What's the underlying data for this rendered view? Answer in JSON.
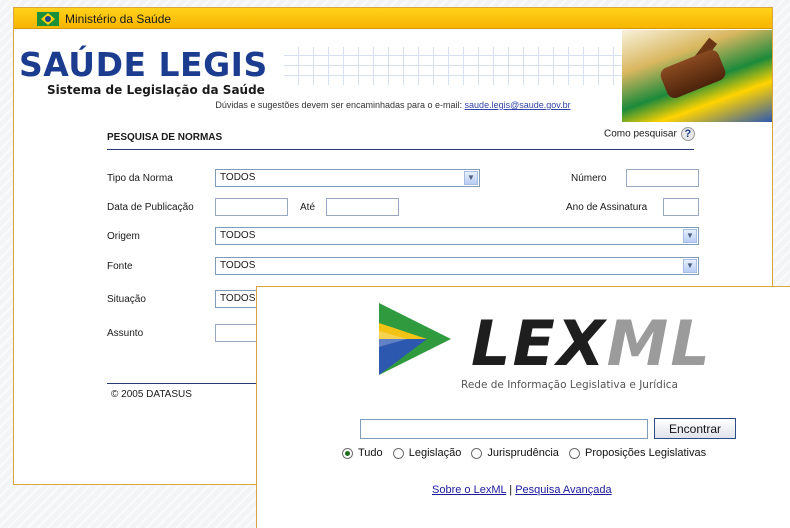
{
  "saude_window": {
    "gov_bar_title": "Ministério da Saúde",
    "logo_title": "SAÚDE LEGIS",
    "logo_subtitle": "Sistema de Legislação da Saúde",
    "contact_text": "Dúvidas e sugestões devem ser encaminhadas para o e-mail:",
    "contact_email": "saude.legis@saude.gov.br",
    "form": {
      "title": "PESQUISA DE NORMAS",
      "help_label": "Como pesquisar",
      "help_icon": "?",
      "tipo_label": "Tipo da Norma",
      "tipo_value": "TODOS",
      "numero_label": "Número",
      "numero_value": "",
      "data_label": "Data de Publicação",
      "ate_label": "Até",
      "ano_label": "Ano de Assinatura",
      "origem_label": "Origem",
      "origem_value": "TODOS",
      "fonte_label": "Fonte",
      "fonte_value": "TODOS",
      "situacao_label": "Situação",
      "situacao_value": "TODOS",
      "assunto_label": "Assunto"
    },
    "footer": "© 2005 DATASUS"
  },
  "lexml_window": {
    "logo_word_a": "LEX",
    "logo_word_b": "ML",
    "tagline": "Rede de Informação Legislativa e Jurídica",
    "search_value": "",
    "search_button": "Encontrar",
    "radios": [
      {
        "label": "Tudo",
        "checked": true
      },
      {
        "label": "Legislação",
        "checked": false
      },
      {
        "label": "Jurisprudência",
        "checked": false
      },
      {
        "label": "Proposições Legislativas",
        "checked": false
      }
    ],
    "link_about": "Sobre o LexML",
    "link_separator": "|",
    "link_advanced": "Pesquisa Avançada"
  },
  "colors": {
    "gov_bar": "#ffd21a",
    "logo_blue": "#1c3d8f",
    "window_border": "#d9a441",
    "lex_green": "#2f9a3e",
    "lex_yellow": "#f3c316",
    "lex_blue": "#2d58b0"
  }
}
